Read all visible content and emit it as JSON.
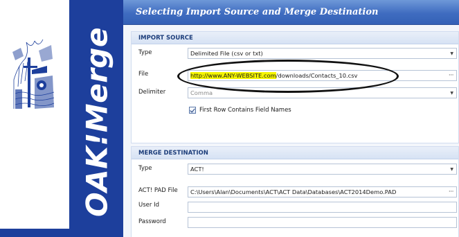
{
  "brand": {
    "title": "OAK!Merge",
    "logo_icon": "tree-scene-icon"
  },
  "header": {
    "title": "Selecting Import Source and Merge Destination"
  },
  "import_source": {
    "section_title": "IMPORT SOURCE",
    "type_label": "Type",
    "type_value": "Delimited File (csv or txt)",
    "file_label": "File",
    "file_value_highlighted": "http://www.ANY-WEBSITE.com",
    "file_value_rest": "/downloads/Contacts_10.csv",
    "delimiter_label": "Delimiter",
    "delimiter_value": "Comma",
    "first_row_label": "First Row Contains Field Names",
    "first_row_checked": true
  },
  "merge_destination": {
    "section_title": "MERGE DESTINATION",
    "type_label": "Type",
    "type_value": "ACT!",
    "pad_file_label": "ACT! PAD File",
    "pad_file_value": "C:\\Users\\Alan\\Documents\\ACT\\ACT Data\\Databases\\ACT2014Demo.PAD",
    "user_id_label": "User Id",
    "user_id_value": "",
    "password_label": "Password",
    "password_value": ""
  },
  "icons": {
    "dropdown": "chevron-down-icon",
    "browse": "ellipsis-icon"
  },
  "colors": {
    "brand_blue": "#1d3f9c",
    "header_blue": "#3f6cc0",
    "highlight": "#f5f500"
  }
}
